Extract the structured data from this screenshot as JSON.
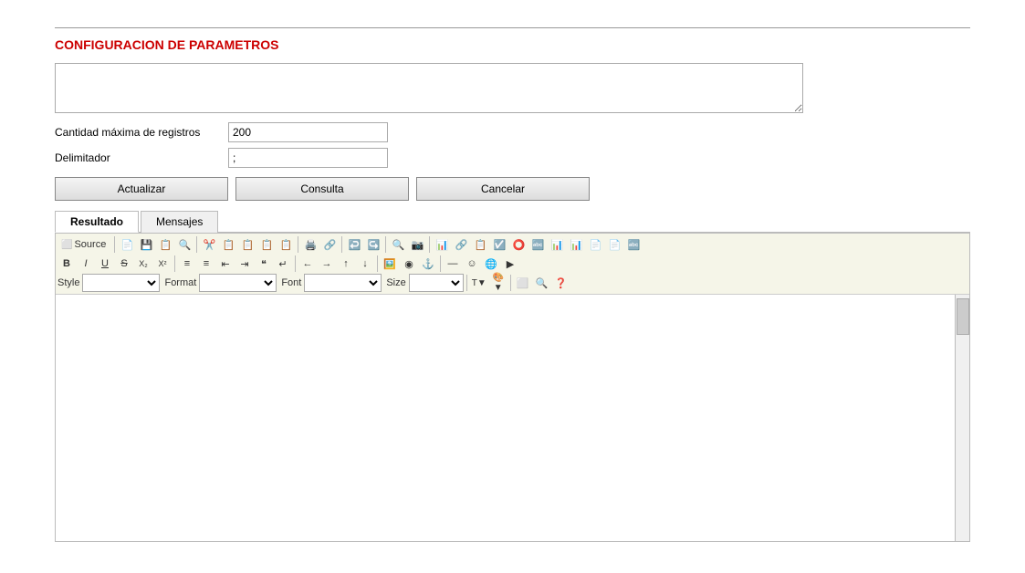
{
  "page": {
    "title": "CONFIGURACION DE PARAMETROS",
    "topLine": true
  },
  "form": {
    "descriptionPlaceholder": "",
    "maxRecordsLabel": "Cantidad máxima de registros",
    "maxRecordsValue": "200",
    "delimiterLabel": "Delimitador",
    "delimiterValue": ";"
  },
  "buttons": {
    "actualizar": "Actualizar",
    "consulta": "Consulta",
    "cancelar": "Cancelar"
  },
  "tabs": [
    {
      "id": "resultado",
      "label": "Resultado",
      "active": true
    },
    {
      "id": "mensajes",
      "label": "Mensajes",
      "active": false
    }
  ],
  "editor": {
    "toolbar": {
      "row1": {
        "sourceLabel": "Source",
        "buttons": [
          "📄",
          "💾",
          "📋",
          "🔍",
          "📊",
          "✂️",
          "📋",
          "📋",
          "📋",
          "📋",
          "🖨️",
          "🔗",
          "↩️",
          "↪️",
          "🔍",
          "📷",
          "📊",
          "☑️",
          "⭕",
          "🔤",
          "📊",
          "📊",
          "📄",
          "📄",
          "🔤"
        ]
      },
      "row2": {
        "buttons": [
          "B",
          "I",
          "U",
          "S",
          "x₂",
          "x²",
          "≡",
          "≡",
          "⇤",
          "⇥",
          "❝",
          "↵",
          "←",
          "→",
          "↑",
          "↓",
          "⬜",
          "🖨️",
          "⚓",
          "🖼️",
          "◉",
          "—",
          "☺",
          "🌐",
          "▶"
        ]
      },
      "row3": {
        "styleLabel": "Style",
        "formatLabel": "Format",
        "fontLabel": "Font",
        "sizeLabel": "Size"
      }
    }
  }
}
